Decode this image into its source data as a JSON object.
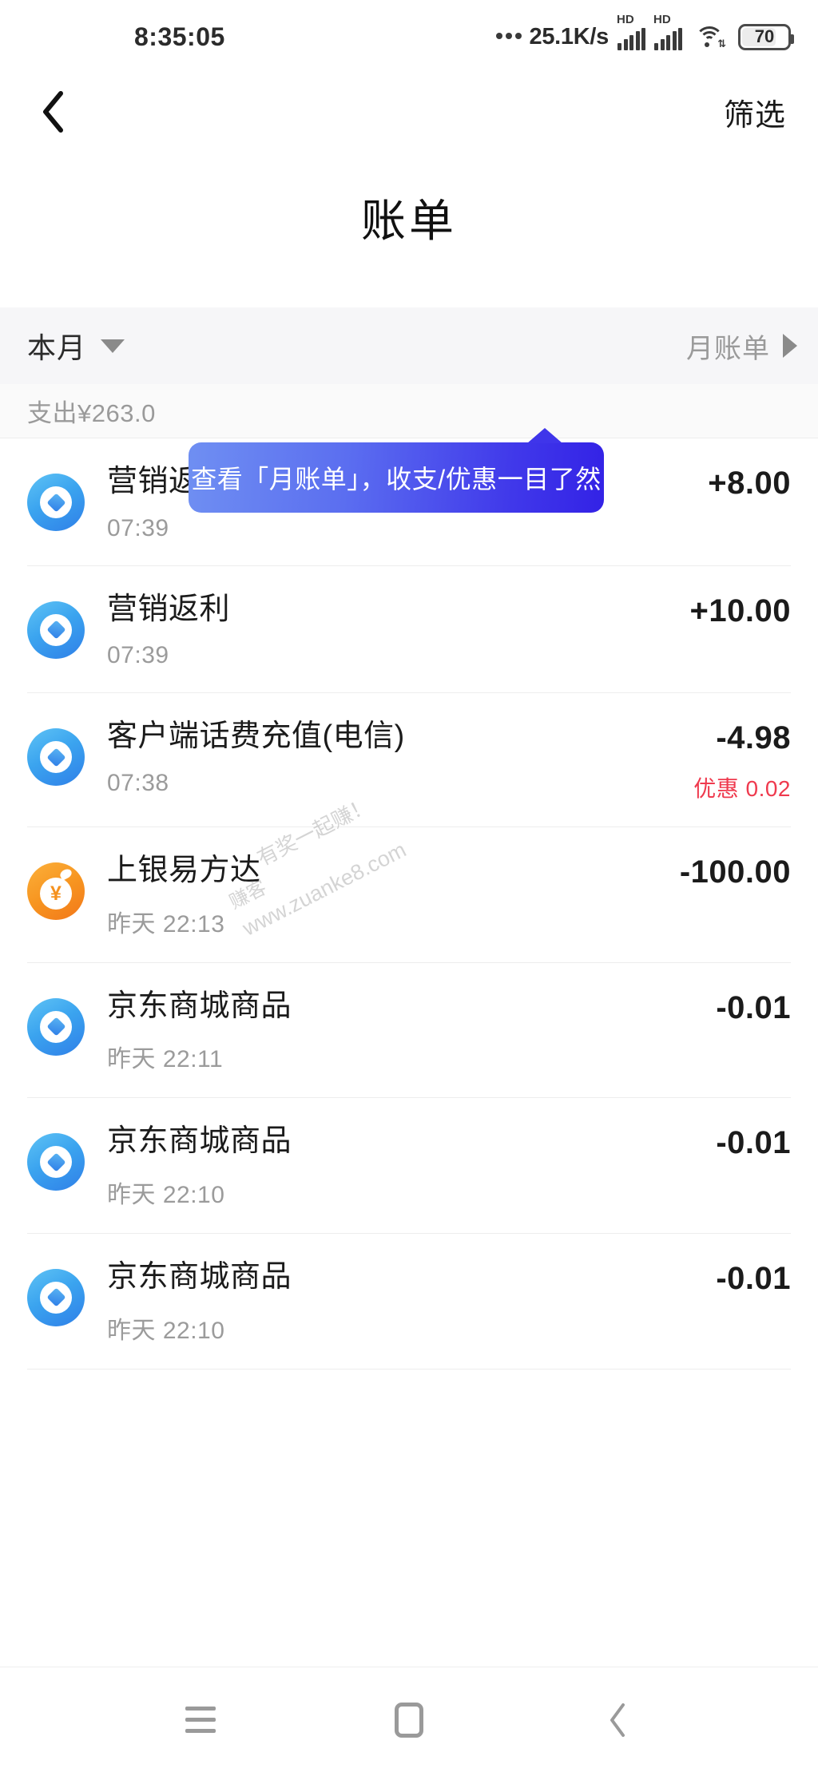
{
  "status_bar": {
    "time": "8:35:05",
    "net_speed": "25.1K/s",
    "dots_icon": "more-dots-icon",
    "signal_1_label": "HD",
    "signal_2_label": "HD",
    "wifi_icon": "wifi-icon",
    "wifi_arrows": "⇅",
    "battery_level": "70"
  },
  "appbar": {
    "back_icon": "back-chevron-icon",
    "filter_label": "筛选"
  },
  "page": {
    "title": "账单"
  },
  "month_bar": {
    "current_label": "本月",
    "caret_down_icon": "chevron-down-icon",
    "monthly_bill_label": "月账单",
    "caret_right_icon": "chevron-right-icon"
  },
  "summary": {
    "text": "支出¥263.0"
  },
  "tooltip": {
    "text": "查看「月账单」，收支/优惠一目了然",
    "gradient_from": "#6f8ff2",
    "gradient_to": "#3322e6"
  },
  "watermark": {
    "line1": "有奖一起赚！",
    "line2": "赚客",
    "line3": "www.zuanke8.com"
  },
  "colors": {
    "income": "#1b1b1b",
    "discount": "#ef3a4e",
    "icon_blue": "#2f7fe8",
    "icon_orange": "#f5911e"
  },
  "transactions": [
    {
      "icon": "jd-pay-blue-icon",
      "icon_type": "donut",
      "title": "营销返利",
      "time": "07:39",
      "amount": "+8.00",
      "discount": null
    },
    {
      "icon": "jd-pay-blue-icon",
      "icon_type": "donut",
      "title": "营销返利",
      "time": "07:39",
      "amount": "+10.00",
      "discount": null
    },
    {
      "icon": "jd-pay-blue-icon",
      "icon_type": "donut",
      "title": "客户端话费充值(电信)",
      "time": "07:38",
      "amount": "-4.98",
      "discount": "优惠 0.02"
    },
    {
      "icon": "fund-yen-orange-icon",
      "icon_type": "yen",
      "title": "上银易方达",
      "time": "昨天 22:13",
      "amount": "-100.00",
      "discount": null
    },
    {
      "icon": "jd-pay-blue-icon",
      "icon_type": "donut",
      "title": "京东商城商品",
      "time": "昨天 22:11",
      "amount": "-0.01",
      "discount": null
    },
    {
      "icon": "jd-pay-blue-icon",
      "icon_type": "donut",
      "title": "京东商城商品",
      "time": "昨天 22:10",
      "amount": "-0.01",
      "discount": null
    },
    {
      "icon": "jd-pay-blue-icon",
      "icon_type": "donut",
      "title": "京东商城商品",
      "time": "昨天 22:10",
      "amount": "-0.01",
      "discount": null
    }
  ],
  "system_nav": {
    "recents_icon": "menu-icon",
    "home_icon": "home-square-icon",
    "back_icon": "back-chevron-icon"
  }
}
